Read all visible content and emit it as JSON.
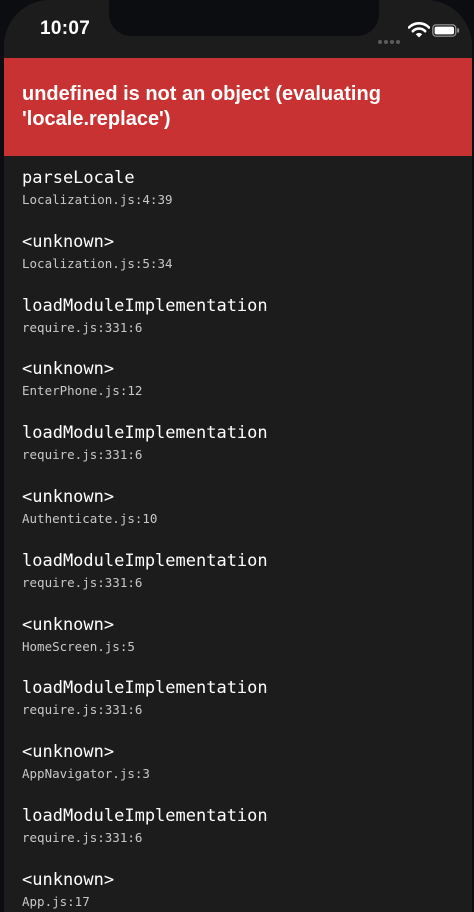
{
  "status_bar": {
    "time": "10:07",
    "icons": [
      "signal-dots-icon",
      "wifi-icon",
      "battery-icon"
    ]
  },
  "error": {
    "message": "undefined is not an object (evaluating 'locale.replace')",
    "color": "#c93233"
  },
  "stack": [
    {
      "name": "parseLocale",
      "location": "Localization.js:4:39"
    },
    {
      "name": "<unknown>",
      "location": "Localization.js:5:34"
    },
    {
      "name": "loadModuleImplementation",
      "location": "require.js:331:6"
    },
    {
      "name": "<unknown>",
      "location": "EnterPhone.js:12"
    },
    {
      "name": "loadModuleImplementation",
      "location": "require.js:331:6"
    },
    {
      "name": "<unknown>",
      "location": "Authenticate.js:10"
    },
    {
      "name": "loadModuleImplementation",
      "location": "require.js:331:6"
    },
    {
      "name": "<unknown>",
      "location": "HomeScreen.js:5"
    },
    {
      "name": "loadModuleImplementation",
      "location": "require.js:331:6"
    },
    {
      "name": "<unknown>",
      "location": "AppNavigator.js:3"
    },
    {
      "name": "loadModuleImplementation",
      "location": "require.js:331:6"
    },
    {
      "name": "<unknown>",
      "location": "App.js:17"
    }
  ]
}
